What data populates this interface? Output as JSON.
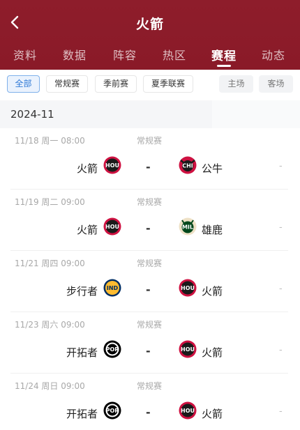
{
  "header": {
    "title": "火箭",
    "tabs": [
      "资料",
      "数据",
      "阵容",
      "热区",
      "赛程",
      "动态"
    ],
    "active_tab": "赛程"
  },
  "filters": {
    "left": [
      "全部",
      "常规赛",
      "季前赛",
      "夏季联赛"
    ],
    "right": [
      "主场",
      "客场"
    ],
    "active": "全部"
  },
  "month": "2024-11",
  "games": [
    {
      "meta": "11/18  周一 08:00",
      "type": "常规赛",
      "home": "火箭",
      "home_abbr": "HOU",
      "score": "-",
      "away": "公牛",
      "away_abbr": "CHI",
      "status": "-"
    },
    {
      "meta": "11/19  周二 09:00",
      "type": "常规赛",
      "home": "火箭",
      "home_abbr": "HOU",
      "score": "-",
      "away": "雄鹿",
      "away_abbr": "MIL",
      "status": "-"
    },
    {
      "meta": "11/21  周四 09:00",
      "type": "常规赛",
      "home": "步行者",
      "home_abbr": "IND",
      "score": "-",
      "away": "火箭",
      "away_abbr": "HOU",
      "status": "-"
    },
    {
      "meta": "11/23  周六 09:00",
      "type": "常规赛",
      "home": "开拓者",
      "home_abbr": "POR",
      "score": "-",
      "away": "火箭",
      "away_abbr": "HOU",
      "status": "-"
    },
    {
      "meta": "11/24  周日 09:00",
      "type": "常规赛",
      "home": "开拓者",
      "home_abbr": "POR",
      "score": "-",
      "away": "火箭",
      "away_abbr": "HOU",
      "status": "-"
    }
  ],
  "icons": {
    "back": "chevron-left-icon"
  },
  "colors": {
    "header_bg": "#8e1d2b",
    "active_chip": "#2e79d6",
    "rockets": "#ce1141",
    "bulls": "#ce1141",
    "bucks": "#00471b",
    "pacers": "#fdbb30",
    "blazers": "#000000"
  }
}
